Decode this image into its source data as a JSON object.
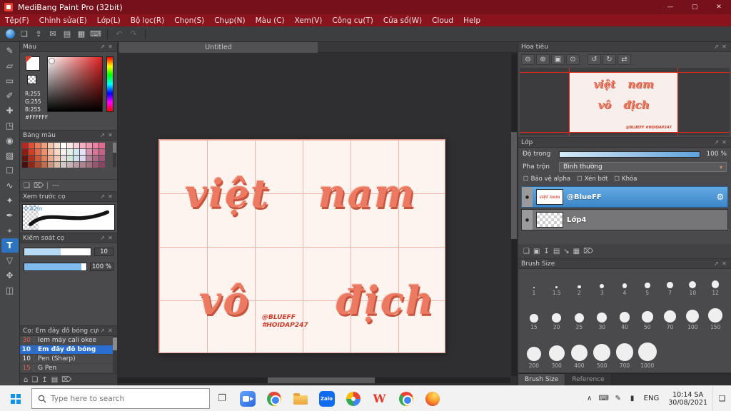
{
  "panel_icons": {
    "popout": "↗",
    "close": "✕"
  },
  "titlebar": {
    "title": "MediBang Paint Pro (32bit)",
    "minimize": "—",
    "maximize": "▢",
    "close": "✕"
  },
  "menubar": [
    "Tệp(F)",
    "Chỉnh sửa(E)",
    "Lớp(L)",
    "Bộ lọc(R)",
    "Chọn(S)",
    "Chụp(N)",
    "Màu (C)",
    "Xem(V)",
    "Công cụ(T)",
    "Cửa sổ(W)",
    "Cloud",
    "Help"
  ],
  "toolbar": [
    {
      "name": "brush-color-indicator",
      "kind": "ball"
    },
    {
      "name": "save-icon",
      "glyph": "❏"
    },
    {
      "name": "upload-icon",
      "glyph": "⇪"
    },
    {
      "name": "message-icon",
      "glyph": "✉"
    },
    {
      "name": "note-icon",
      "glyph": "▤"
    },
    {
      "name": "grid-view-icon",
      "glyph": "▦"
    },
    {
      "name": "shortcut-bar-icon",
      "glyph": "⌨"
    },
    {
      "sep": true
    },
    {
      "name": "undo-icon",
      "glyph": "↶",
      "disabled": true
    },
    {
      "name": "redo-icon",
      "glyph": "↷",
      "disabled": true
    },
    {
      "sep": true
    }
  ],
  "tools": [
    {
      "name": "pen-tool",
      "glyph": "✎"
    },
    {
      "name": "eraser-tool",
      "glyph": "▱"
    },
    {
      "name": "marquee-tool",
      "glyph": "▭"
    },
    {
      "name": "brush-tool",
      "glyph": "✐"
    },
    {
      "name": "move-tool",
      "glyph": "✚"
    },
    {
      "name": "transform-tool",
      "glyph": "◳"
    },
    {
      "name": "bucket-tool",
      "glyph": "◉"
    },
    {
      "name": "gradient-tool",
      "glyph": "▨"
    },
    {
      "name": "select-rect-tool",
      "glyph": "☐"
    },
    {
      "name": "lasso-tool",
      "glyph": "∿"
    },
    {
      "name": "magic-wand-tool",
      "glyph": "✦"
    },
    {
      "name": "pen-nib-tool",
      "glyph": "✒"
    },
    {
      "name": "operation-tool",
      "glyph": "⌖"
    },
    {
      "name": "text-tool",
      "glyph": "T",
      "selected": true
    },
    {
      "name": "eyedropper-tool",
      "glyph": "▽"
    },
    {
      "name": "hand-tool",
      "glyph": "✥"
    },
    {
      "name": "divide-tool",
      "glyph": "◫"
    }
  ],
  "color_panel": {
    "title": "Màu",
    "values": [
      "R:255",
      "G:255",
      "B:255",
      "#FFFFFF"
    ]
  },
  "palette_panel": {
    "title": "Bảng màu",
    "footer_label": "---",
    "footer_icons": [
      {
        "name": "add-swatch-icon",
        "glyph": "❏"
      },
      {
        "name": "delete-swatch-icon",
        "glyph": "⌦"
      }
    ],
    "swatches": [
      "#c0271c",
      "#e05038",
      "#e87a58",
      "#f0a080",
      "#f6c4ac",
      "#fbe0d2",
      "#ffffff",
      "#fce8e8",
      "#f8d0d8",
      "#f4b0c0",
      "#f098b0",
      "#ec80a0",
      "#e86890",
      "#8e1a12",
      "#d04028",
      "#e06848",
      "#ec9070",
      "#f4b89c",
      "#f9d8c6",
      "#f6f0ee",
      "#e4f0e6",
      "#d2e8f4",
      "#e8e0f4",
      "#d890a8",
      "#d07898",
      "#c86088",
      "#6a120c",
      "#b03020",
      "#cc5838",
      "#dc8060",
      "#eaa88c",
      "#f2c8b6",
      "#e8e0de",
      "#cfe8d8",
      "#cfe0f0",
      "#e0d8f0",
      "#b88498",
      "#ac6c88",
      "#a05478",
      "#48100a",
      "#902818",
      "#ac4830",
      "#bc7050",
      "#ca9880",
      "#d8b8a6",
      "#d0c8c6",
      "#c4b2b8",
      "#b89ca4",
      "#ac8490",
      "#a07080",
      "#945870",
      "#884460"
    ]
  },
  "preview_panel": {
    "title": "Xem trước cọ",
    "size_label": "0.42m"
  },
  "control_panel": {
    "title": "Kiểm soát cọ",
    "rows": [
      {
        "value": "10",
        "fill": 55
      },
      {
        "value": "100 %",
        "fill": 92
      }
    ]
  },
  "brush_panel": {
    "title": "Cọ: Em đây đồ bóng cực xịn",
    "items": [
      {
        "size": "30",
        "name": "Iem máy cali okee",
        "size_color": "#e0604e"
      },
      {
        "size": "10",
        "name": "Em đây đồ bóng",
        "selected": true
      },
      {
        "size": "10",
        "name": "Pen (Sharp)"
      },
      {
        "size": "15",
        "name": "G Pen",
        "size_color": "#e0604e"
      }
    ],
    "bottom_icons": [
      {
        "name": "home-icon",
        "glyph": "⌂"
      },
      {
        "name": "add-brush-icon",
        "glyph": "❏"
      },
      {
        "name": "brush-up-icon",
        "glyph": "↥"
      },
      {
        "name": "brush-folder-icon",
        "glyph": "▤"
      },
      {
        "name": "delete-brush-icon",
        "glyph": "⌦"
      }
    ]
  },
  "canvas": {
    "tab": "Untitled",
    "words": [
      "việt",
      "nam",
      "vô",
      "địch"
    ],
    "credits": [
      "@BLUEFF",
      "#HOIDAP247"
    ]
  },
  "navigator": {
    "title": "Hoa tiêu",
    "buttons": [
      {
        "name": "zoom-out-icon",
        "glyph": "⊖"
      },
      {
        "name": "zoom-in-icon",
        "glyph": "⊕"
      },
      {
        "name": "fit-window-icon",
        "glyph": "▣"
      },
      {
        "name": "zoom-actual-icon",
        "glyph": "⊙"
      },
      {
        "sep": true
      },
      {
        "name": "rotate-left-icon",
        "glyph": "↺"
      },
      {
        "name": "rotate-right-icon",
        "glyph": "↻"
      },
      {
        "name": "flip-horizontal-icon",
        "glyph": "⇄"
      }
    ]
  },
  "layers_panel": {
    "title": "Lớp",
    "opacity_label": "Độ trong",
    "opacity_value": "100 %",
    "blend_label": "Pha trộn",
    "blend_value": "Bình thường",
    "caret": "▾",
    "checkboxes": [
      "Bảo vệ alpha",
      "Xén bớt",
      "Khóa"
    ],
    "checkbox_glyph": "☐",
    "eye_glyph": "●",
    "gear_glyph": "⚙",
    "layers": [
      {
        "name": "@BlueFF",
        "selected": true
      },
      {
        "name": "Lớp4",
        "selected": false
      }
    ],
    "toolbar": [
      {
        "name": "new-layer-icon",
        "glyph": "❏"
      },
      {
        "name": "duplicate-layer-icon",
        "glyph": "▣"
      },
      {
        "name": "transfer-layer-icon",
        "glyph": "↧"
      },
      {
        "name": "new-folder-icon",
        "glyph": "▤"
      },
      {
        "name": "merge-layer-icon",
        "glyph": "↘"
      },
      {
        "name": "layer-grid-icon",
        "glyph": "▦"
      },
      {
        "name": "delete-layer-icon",
        "glyph": "⌦"
      }
    ]
  },
  "brush_size_panel": {
    "title": "Brush Size",
    "sizes": [
      "1",
      "1.5",
      "2",
      "3",
      "4",
      "5",
      "7",
      "10",
      "12",
      "15",
      "20",
      "25",
      "30",
      "40",
      "50",
      "70",
      "100",
      "150",
      "200",
      "300",
      "400",
      "500",
      "700",
      "1000"
    ],
    "tabs": [
      {
        "label": "Brush Size",
        "active": true
      },
      {
        "label": "Reference",
        "active": false
      }
    ]
  },
  "taskbar": {
    "search_placeholder": "Type here to search",
    "task_view_glyph": "❐",
    "apps": [
      {
        "name": "zoom-icon",
        "kind": "zoom"
      },
      {
        "name": "chrome-icon",
        "kind": "chrome"
      },
      {
        "name": "file-explorer-icon",
        "kind": "folder"
      },
      {
        "name": "zalo-icon",
        "kind": "zalo",
        "label": "Zalo"
      },
      {
        "name": "google-photos-icon",
        "kind": "photos"
      },
      {
        "name": "wps-office-icon",
        "kind": "wps",
        "label": "W"
      },
      {
        "name": "chrome-profile-icon",
        "kind": "chrome"
      },
      {
        "name": "firefox-icon",
        "kind": "firefox"
      }
    ],
    "tray": [
      {
        "name": "tray-expand-icon",
        "glyph": "∧"
      },
      {
        "name": "touch-keyboard-icon",
        "glyph": "⌨"
      },
      {
        "name": "pen-input-icon",
        "glyph": "✎"
      },
      {
        "name": "battery-icon",
        "glyph": "▮"
      }
    ],
    "lang": "ENG",
    "time": "10:14 SA",
    "date": "30/08/2021",
    "action_center_glyph": "❏"
  }
}
